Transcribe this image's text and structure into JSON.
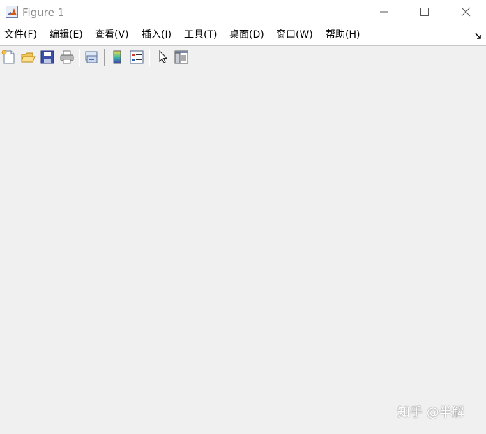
{
  "window": {
    "title": "Figure 1",
    "app_icon": "matlab-logo-icon",
    "controls": {
      "minimize_icon": "minimize-icon",
      "maximize_icon": "maximize-icon",
      "close_icon": "close-icon"
    }
  },
  "menubar": {
    "items": [
      {
        "label": "文件(F)"
      },
      {
        "label": "编辑(E)"
      },
      {
        "label": "查看(V)"
      },
      {
        "label": "插入(I)"
      },
      {
        "label": "工具(T)"
      },
      {
        "label": "桌面(D)"
      },
      {
        "label": "窗口(W)"
      },
      {
        "label": "帮助(H)"
      }
    ],
    "dock_icon": "dock-arrow-icon"
  },
  "toolbar": {
    "tools": [
      {
        "icon": "new-figure-icon"
      },
      {
        "icon": "open-file-icon"
      },
      {
        "icon": "save-icon"
      },
      {
        "icon": "print-icon"
      },
      {
        "icon": "link-plot-icon"
      },
      {
        "icon": "insert-colorbar-icon"
      },
      {
        "icon": "insert-legend-icon"
      },
      {
        "icon": "edit-plot-pointer-icon"
      },
      {
        "icon": "property-inspector-icon"
      }
    ]
  },
  "watermark": {
    "text": "知乎 @半解"
  },
  "colors": {
    "window_bg": "#f0f0f0",
    "titlebar_bg": "#ffffff",
    "title_text": "#8a8a8a"
  }
}
